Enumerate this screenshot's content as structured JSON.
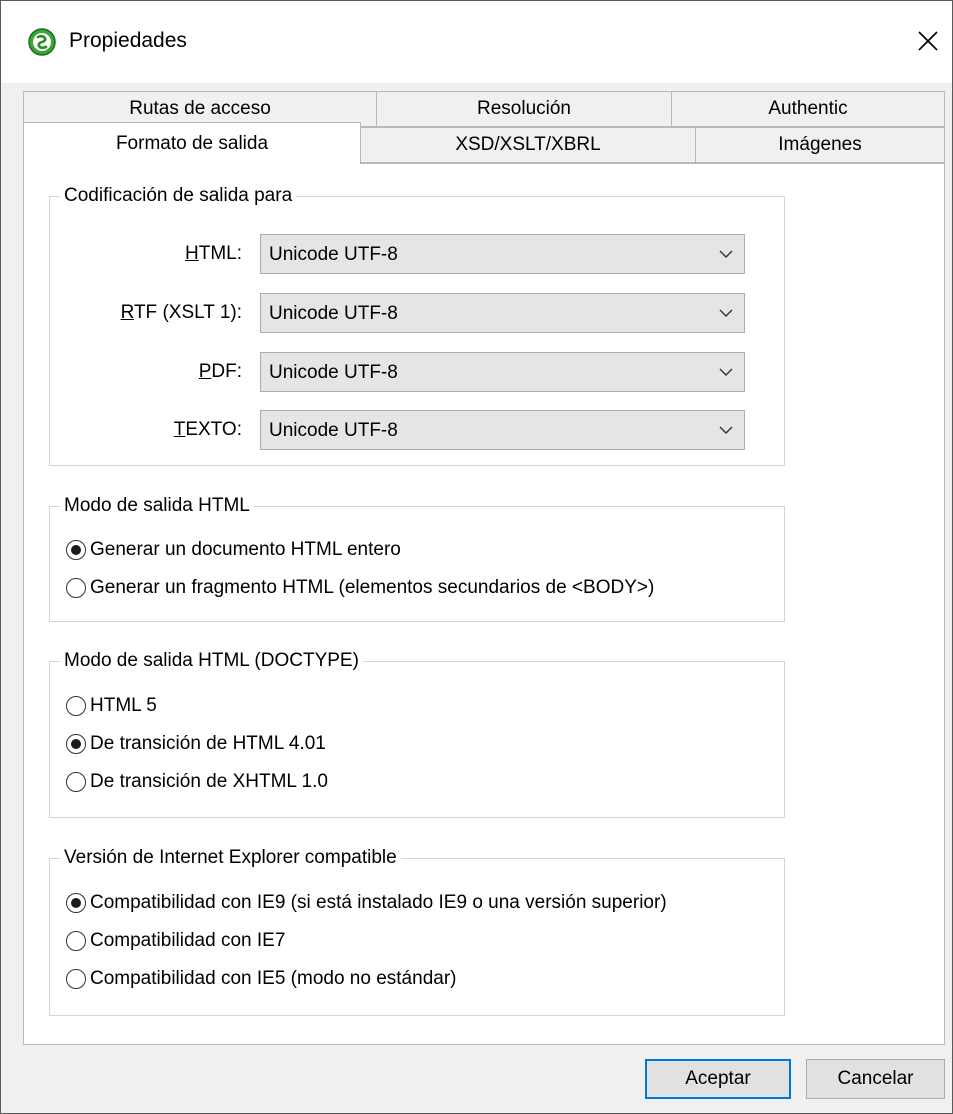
{
  "window": {
    "title": "Propiedades"
  },
  "tabs": {
    "back_row": [
      "Rutas de acceso",
      "Resolución",
      "Authentic"
    ],
    "front_row": [
      "Formato de salida",
      "XSD/XSLT/XBRL",
      "Imágenes"
    ],
    "active": "Formato de salida"
  },
  "encoding": {
    "legend": "Codificación de salida para",
    "rows": [
      {
        "accel": "H",
        "rest": "TML:",
        "value": "Unicode UTF-8"
      },
      {
        "accel": "R",
        "rest": "TF (XSLT 1):",
        "value": "Unicode UTF-8"
      },
      {
        "accel": "P",
        "rest": "DF:",
        "value": "Unicode UTF-8"
      },
      {
        "accel": "T",
        "rest": "EXTO:",
        "value": "Unicode UTF-8"
      }
    ]
  },
  "html_mode": {
    "legend": "Modo de salida HTML",
    "options": [
      {
        "label": "Generar un documento HTML entero",
        "selected": true
      },
      {
        "label": "Generar un fragmento HTML (elementos secundarios de <BODY>)",
        "selected": false
      }
    ]
  },
  "doctype_mode": {
    "legend": "Modo de salida HTML (DOCTYPE)",
    "options": [
      {
        "label": "HTML 5",
        "selected": false
      },
      {
        "label": "De transición de HTML 4.01",
        "selected": true
      },
      {
        "label": "De transición de XHTML 1.0",
        "selected": false
      }
    ]
  },
  "ie_mode": {
    "legend": "Versión de Internet Explorer compatible",
    "options": [
      {
        "label": "Compatibilidad con IE9 (si está instalado IE9 o una versión superior)",
        "selected": true
      },
      {
        "label": "Compatibilidad con IE7",
        "selected": false
      },
      {
        "label": "Compatibilidad con IE5 (modo no estándar)",
        "selected": false
      }
    ]
  },
  "buttons": {
    "ok": "Aceptar",
    "cancel": "Cancelar"
  },
  "colors": {
    "app_icon": "#3aa637",
    "default_button_border": "#0078d7"
  },
  "icons": {
    "app": "altova-logo-icon",
    "close": "close-icon",
    "dropdown": "chevron-down-icon",
    "radio": "radio-button-icon"
  }
}
